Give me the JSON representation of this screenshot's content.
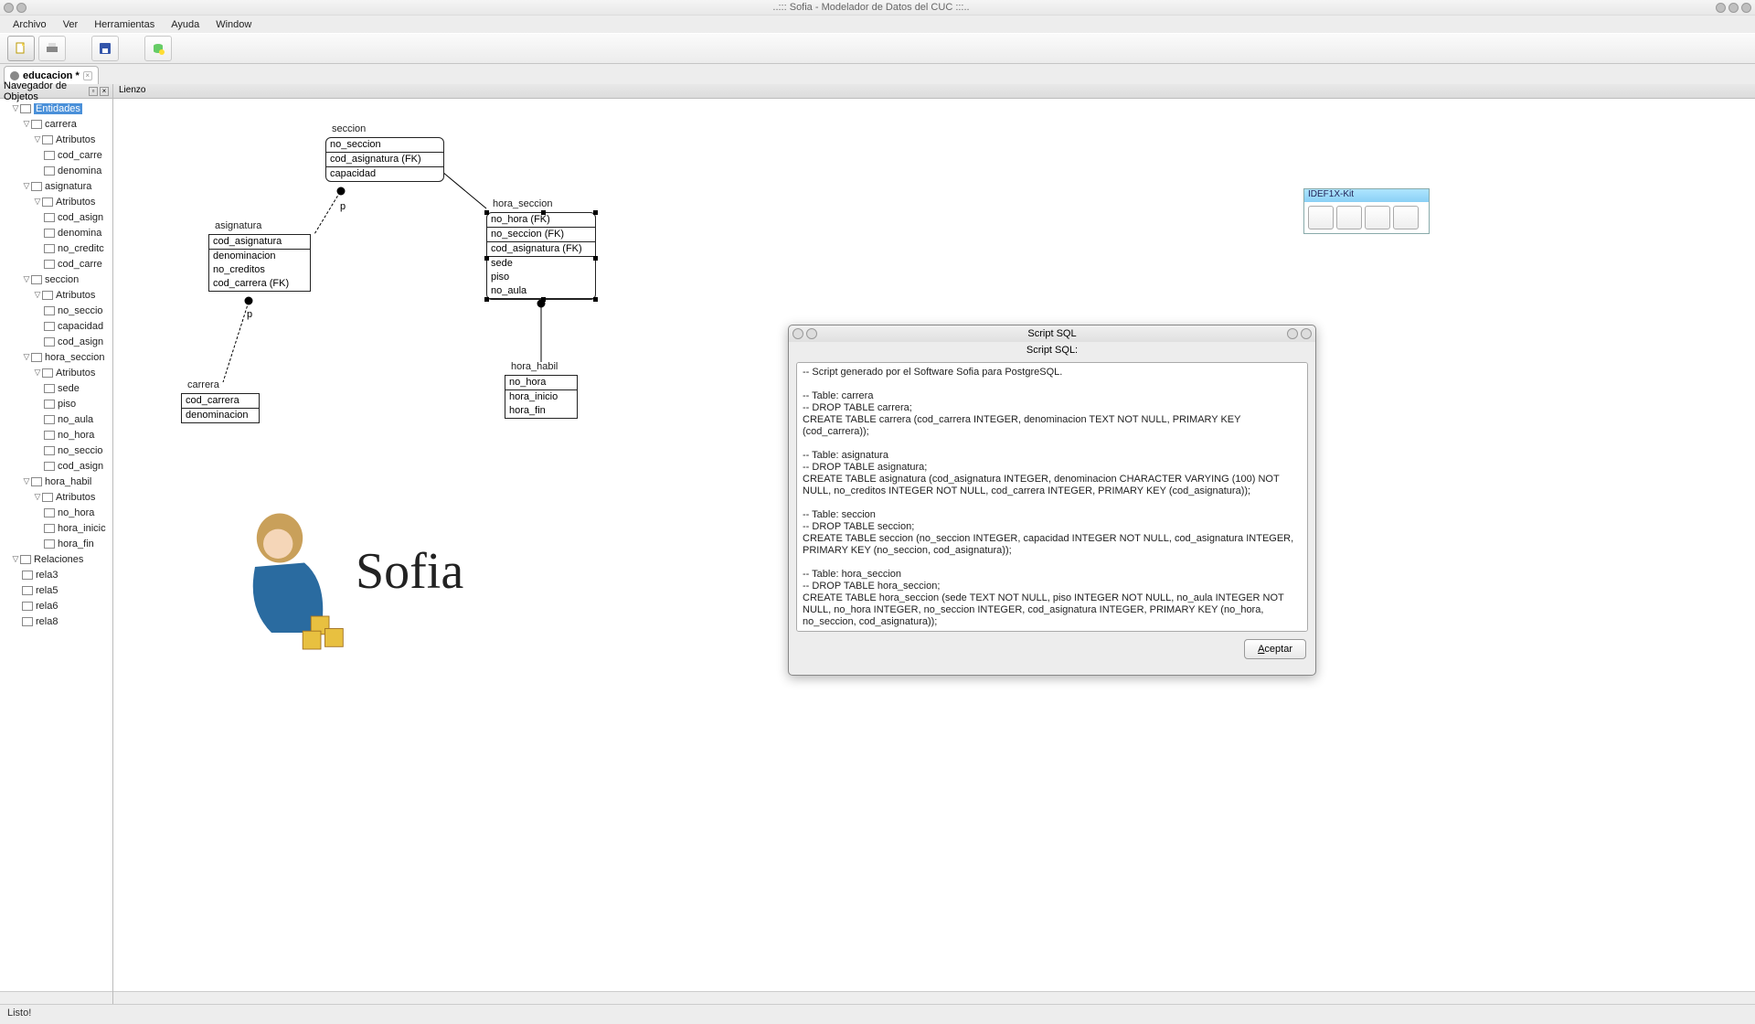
{
  "window": {
    "title": "..::: Sofia - Modelador de Datos del CUC :::.."
  },
  "menu": {
    "archivo": "Archivo",
    "ver": "Ver",
    "herramientas": "Herramientas",
    "ayuda": "Ayuda",
    "window": "Window"
  },
  "tab": {
    "name": "educacion *"
  },
  "sidebar": {
    "header": "Navegador de Objetos",
    "tree": {
      "entidades": "Entidades",
      "carrera": "carrera",
      "atributos": "Atributos",
      "cod_carre": "cod_carre",
      "denomina": "denomina",
      "asignatura": "asignatura",
      "cod_asign": "cod_asign",
      "no_credito": "no_creditc",
      "seccion": "seccion",
      "no_seccio": "no_seccio",
      "capacidad": "capacidad",
      "hora_seccion": "hora_seccion",
      "sede": "sede",
      "piso": "piso",
      "no_aula": "no_aula",
      "no_hora": "no_hora",
      "hora_habil": "hora_habil",
      "hora_inicio": "hora_inicic",
      "hora_fin": "hora_fin",
      "relaciones": "Relaciones",
      "rela3": "rela3",
      "rela5": "rela5",
      "rela6": "rela6",
      "rela8": "rela8"
    }
  },
  "canvas": {
    "header": "Lienzo",
    "seccion": {
      "title": "seccion",
      "k1": "no_seccion",
      "k2": "cod_asignatura (FK)",
      "a1": "capacidad"
    },
    "asignatura": {
      "title": "asignatura",
      "k1": "cod_asignatura",
      "a1": "denominacion",
      "a2": "no_creditos",
      "a3": "cod_carrera (FK)"
    },
    "hora_seccion": {
      "title": "hora_seccion",
      "k1": "no_hora (FK)",
      "k2": "no_seccion (FK)",
      "k3": "cod_asignatura (FK)",
      "a1": "sede",
      "a2": "piso",
      "a3": "no_aula"
    },
    "carrera": {
      "title": "carrera",
      "k1": "cod_carrera",
      "a1": "denominacion"
    },
    "hora_habil": {
      "title": "hora_habil",
      "k1": "no_hora",
      "a1": "hora_inicio",
      "a2": "hora_fin"
    },
    "palette": "IDEF1X-Kit",
    "p_label": "p"
  },
  "dialog": {
    "title": "Script SQL",
    "subtitle": "Script SQL:",
    "content": "-- Script generado por el Software Sofia para PostgreSQL.\n\n-- Table: carrera\n-- DROP TABLE carrera;\nCREATE TABLE carrera (cod_carrera INTEGER, denominacion TEXT NOT NULL, PRIMARY KEY (cod_carrera));\n\n-- Table: asignatura\n-- DROP TABLE asignatura;\nCREATE TABLE asignatura (cod_asignatura INTEGER, denominacion CHARACTER VARYING (100) NOT NULL, no_creditos INTEGER NOT NULL, cod_carrera INTEGER, PRIMARY KEY (cod_asignatura));\n\n-- Table: seccion\n-- DROP TABLE seccion;\nCREATE TABLE seccion (no_seccion INTEGER, capacidad INTEGER NOT NULL, cod_asignatura INTEGER, PRIMARY KEY (no_seccion, cod_asignatura));\n\n-- Table: hora_seccion\n-- DROP TABLE hora_seccion;\nCREATE TABLE hora_seccion (sede TEXT NOT NULL, piso INTEGER NOT NULL, no_aula INTEGER NOT NULL, no_hora INTEGER, no_seccion INTEGER, cod_asignatura INTEGER, PRIMARY KEY (no_hora, no_seccion, cod_asignatura));\n\n-- Table: hora_habil\n-- DROP TABLE hora_habil;\nCREATE TABLE hora_habil (no_hora INTEGER, hora_inicio TIME WITHOUT TIME ZONE NOT NULL, hora_fin TIME",
    "accept": "Aceptar"
  },
  "status": {
    "text": "Listo!"
  },
  "logo": {
    "text": "Sofia"
  }
}
